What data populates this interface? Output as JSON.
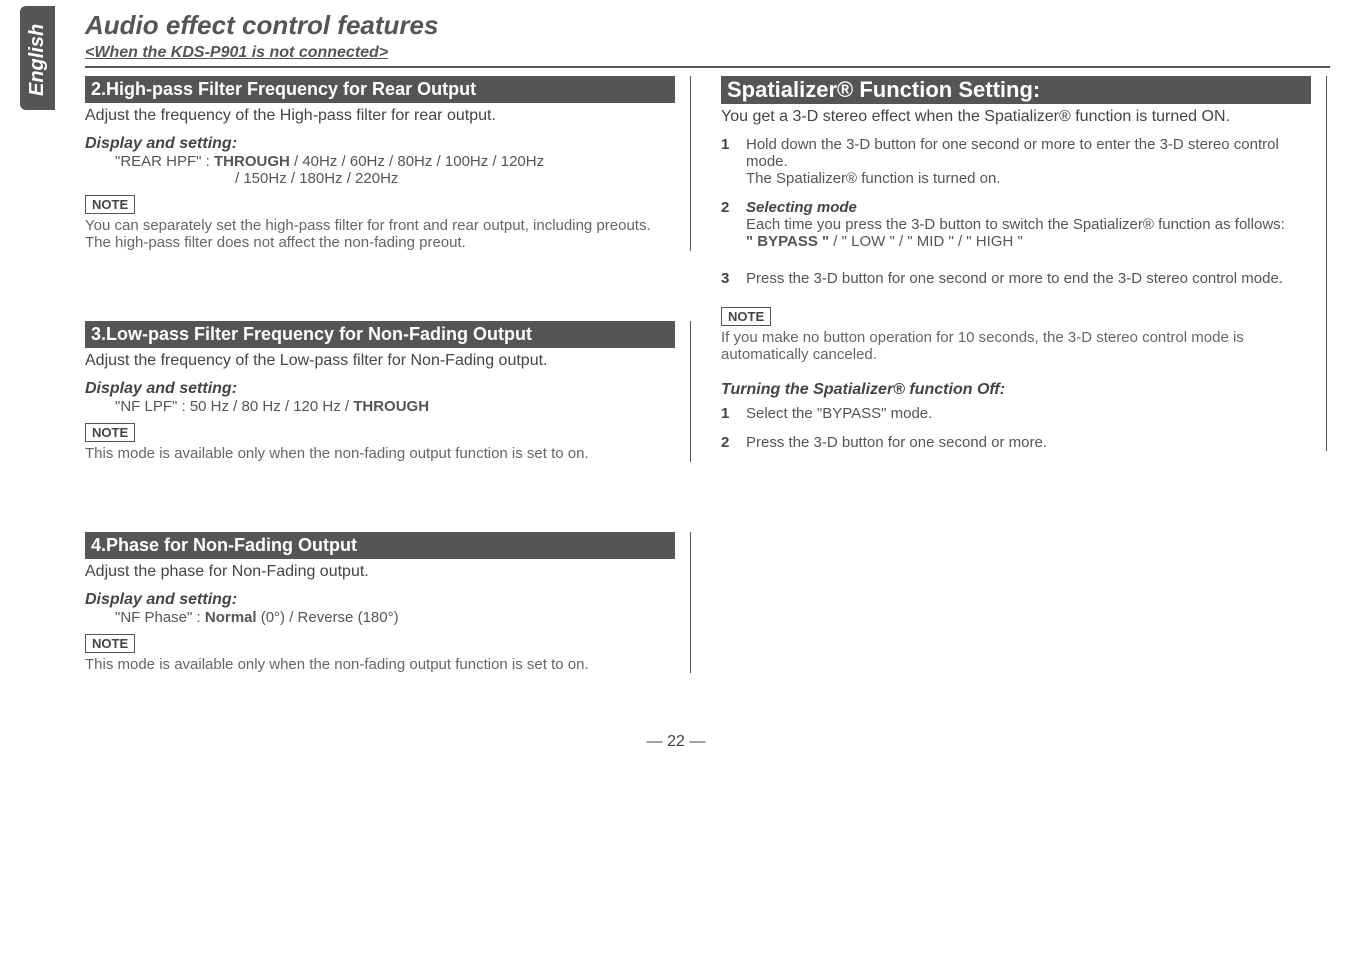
{
  "language_tab": "English",
  "page_title": "Audio effect control features",
  "sub_title": "<When the KDS-P901 is not connected>",
  "page_number": "— 22 —",
  "note_label": "NOTE",
  "left": {
    "sec2": {
      "header": "2.High-pass Filter Frequency  for Rear Output",
      "lead": "Adjust the frequency of the High-pass filter for rear output.",
      "display_label": "Display and setting:",
      "line1a": "\"REAR HPF\" : ",
      "line1b": "THROUGH",
      "line1c": " / 40Hz / 60Hz / 80Hz / 100Hz / 120Hz",
      "line2": "/ 150Hz / 180Hz / 220Hz",
      "note": "You can separately set the high-pass filter for front and rear output, including preouts. The high-pass filter does not affect the non-fading preout."
    },
    "sec3": {
      "header": "3.Low-pass Filter Frequency  for Non-Fading Output",
      "lead": "Adjust the frequency of the Low-pass filter for Non-Fading output.",
      "display_label": "Display and setting:",
      "line1a": "\"NF LPF\" : 50 Hz / 80 Hz / 120 Hz / ",
      "line1b": "THROUGH",
      "note": "This mode is available only when the non-fading output function is set to on."
    },
    "sec4": {
      "header": "4.Phase for Non-Fading Output",
      "lead": "Adjust the phase for Non-Fading output.",
      "display_label": "Display and setting:",
      "line1a": "\"NF Phase\" : ",
      "line1b": "Normal",
      "line1c": " (0°) / Reverse (180°)",
      "note": "This mode is available only when the non-fading output function is set to on."
    }
  },
  "right": {
    "spatial": {
      "header": "Spatializer® Function Setting:",
      "lead": "You get a 3-D stereo effect when the Spatializer® function is turned ON.",
      "step1": "Hold down the 3-D button for one second or more to enter the 3-D stereo control mode.",
      "step1b": "The Spatializer® function is turned on.",
      "step2_title": "Selecting mode",
      "step2_body": "Each time you press the 3-D button to switch the Spatializer® function as follows:",
      "step2_opts_a": "\" BYPASS \"",
      "step2_opts_b": " / \" LOW \" / \" MID \" / \" HIGH \"",
      "step3": "Press the 3-D button for one second or more to end the 3-D stereo control mode.",
      "note": "If you make no button operation for 10 seconds, the 3-D stereo control mode is automatically canceled.",
      "off_title": "Turning the Spatializer® function Off:",
      "off_step1": "Select the \"BYPASS\" mode.",
      "off_step2": "Press the 3-D button for one second or more."
    }
  }
}
